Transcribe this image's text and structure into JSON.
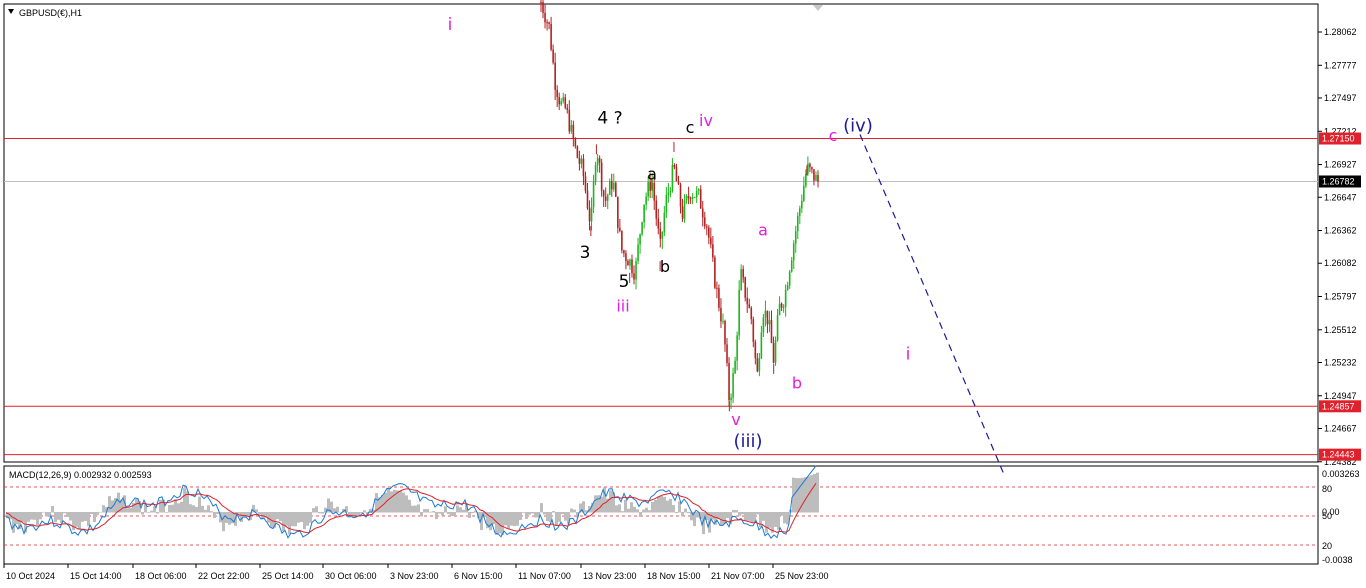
{
  "window": {
    "title": "GBPUSD(€),H1",
    "menu_icon": "triangle-down-icon"
  },
  "colors": {
    "bull_candle": "#1fb51f",
    "bear_candle": "#b22222",
    "level_line": "#e0202a",
    "current_price_line": "#c0c0c0",
    "wave_black": "#000000",
    "wave_magenta": "#e020e0",
    "wave_blue": "#1b1b9a",
    "macd_histogram": "#bdbdbd",
    "macd_line": "#1a7ad6",
    "signal_line": "#e0202a"
  },
  "chart_data": {
    "type": "candlestick",
    "symbol": "GBPUSD",
    "timeframe": "H1",
    "price_axis": {
      "ticks": [
        "1.28062",
        "1.27777",
        "1.27497",
        "1.27212",
        "1.26927",
        "1.26647",
        "1.26362",
        "1.26082",
        "1.25797",
        "1.25512",
        "1.25232",
        "1.24947",
        "1.24667",
        "1.24382"
      ],
      "range": [
        1.2431,
        1.2832
      ]
    },
    "price_path": [
      [
        0.0,
        1.2832
      ],
      [
        0.03,
        1.281
      ],
      [
        0.05,
        1.2765
      ],
      [
        0.07,
        1.2745
      ],
      [
        0.09,
        1.274
      ],
      [
        0.11,
        1.272
      ],
      [
        0.13,
        1.27
      ],
      [
        0.15,
        1.2688
      ],
      [
        0.18,
        1.264
      ],
      [
        0.2,
        1.271
      ],
      [
        0.23,
        1.266
      ],
      [
        0.26,
        1.268
      ],
      [
        0.29,
        1.262
      ],
      [
        0.32,
        1.261
      ],
      [
        0.34,
        1.26
      ],
      [
        0.37,
        1.266
      ],
      [
        0.4,
        1.268
      ],
      [
        0.43,
        1.262
      ],
      [
        0.45,
        1.266
      ],
      [
        0.48,
        1.269
      ],
      [
        0.51,
        1.265
      ],
      [
        0.54,
        1.267
      ],
      [
        0.57,
        1.2665
      ],
      [
        0.6,
        1.264
      ],
      [
        0.63,
        1.259
      ],
      [
        0.66,
        1.255
      ],
      [
        0.68,
        1.249
      ],
      [
        0.7,
        1.252
      ],
      [
        0.72,
        1.26
      ],
      [
        0.74,
        1.258
      ],
      [
        0.76,
        1.256
      ],
      [
        0.78,
        1.251
      ],
      [
        0.8,
        1.257
      ],
      [
        0.82,
        1.256
      ],
      [
        0.84,
        1.2525
      ],
      [
        0.86,
        1.257
      ],
      [
        0.88,
        1.258
      ],
      [
        0.9,
        1.261
      ],
      [
        0.93,
        1.265
      ],
      [
        0.96,
        1.269
      ],
      [
        1.0,
        1.2678
      ]
    ],
    "wave_points": [
      [
        0.0,
        1.2832
      ],
      [
        0.18,
        1.264
      ],
      [
        0.2,
        1.271
      ],
      [
        0.32,
        1.26
      ],
      [
        0.4,
        1.268
      ],
      [
        0.43,
        1.261
      ],
      [
        0.48,
        1.2712
      ],
      [
        0.68,
        1.249
      ],
      [
        0.73,
        1.26
      ],
      [
        0.84,
        1.2522
      ],
      [
        0.96,
        1.2692
      ]
    ],
    "horizontal_levels": [
      {
        "label": "1.27150",
        "value": 1.2715
      },
      {
        "label": "1.24857",
        "value": 1.24857
      },
      {
        "label": "1.24443",
        "value": 1.24443
      }
    ],
    "current_price": {
      "label": "1.26782",
      "value": 1.26782
    },
    "projection_line": {
      "from": 1.2715,
      "to": 1.2435
    },
    "time_axis": [
      "10 Oct 2024",
      "15 Oct 14:00",
      "18 Oct 06:00",
      "22 Oct 22:00",
      "25 Oct 14:00",
      "30 Oct 06:00",
      "3 Nov 23:00",
      "6 Nov 15:00",
      "11 Nov 07:00",
      "13 Nov 23:00",
      "18 Nov 15:00",
      "21 Nov 07:00",
      "25 Nov 23:00"
    ],
    "wave_labels": [
      {
        "text": "i",
        "color": "magenta",
        "price": 1.2813
      },
      {
        "text": "4 ?",
        "color": "black",
        "price": 1.2733
      },
      {
        "text": "c",
        "color": "black",
        "price": 1.2725
      },
      {
        "text": "iv",
        "color": "magenta",
        "price": 1.2731
      },
      {
        "text": "c",
        "color": "magenta",
        "price": 1.2718
      },
      {
        "text": "(iv)",
        "color": "blue",
        "price": 1.2726
      },
      {
        "text": "a",
        "color": "black",
        "price": 1.2685
      },
      {
        "text": "3",
        "color": "black",
        "price": 1.2618
      },
      {
        "text": "b",
        "color": "black",
        "price": 1.2606
      },
      {
        "text": "5",
        "color": "black",
        "price": 1.2593
      },
      {
        "text": "iii",
        "color": "magenta",
        "price": 1.2572
      },
      {
        "text": "a",
        "color": "magenta",
        "price": 1.2637
      },
      {
        "text": "i",
        "color": "magenta",
        "price": 1.2531
      },
      {
        "text": "b",
        "color": "magenta",
        "price": 1.2506
      },
      {
        "text": "v",
        "color": "magenta",
        "price": 1.2475
      },
      {
        "text": "(iii)",
        "color": "blue",
        "price": 1.2456
      }
    ],
    "macd": {
      "title": "MACD(12,26,9) 0.002932 0.002593",
      "params": [
        12,
        26,
        9
      ],
      "macd_value": 0.002932,
      "signal_value": 0.002593,
      "axis_labels": [
        "0.003263",
        "80",
        "0.00",
        "50",
        "20",
        "-0.0038"
      ],
      "levels": [
        80,
        50,
        20
      ]
    }
  }
}
